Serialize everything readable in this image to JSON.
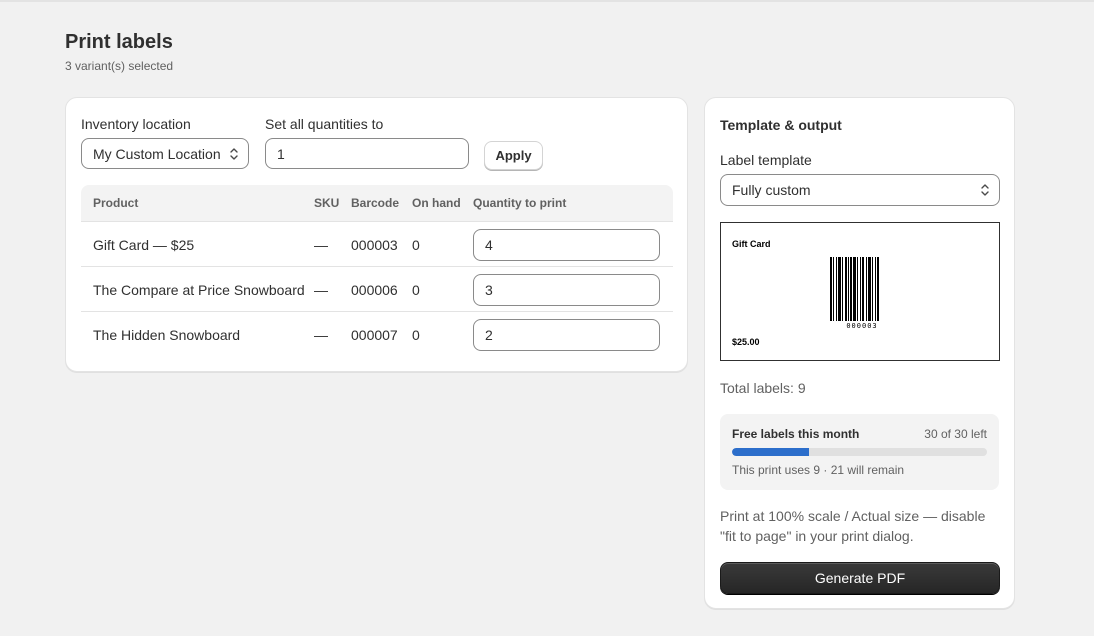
{
  "header": {
    "title": "Print labels",
    "subtitle": "3 variant(s) selected"
  },
  "controls": {
    "location_label": "Inventory location",
    "location_value": "My Custom Location",
    "set_all_label": "Set all quantities to",
    "set_all_value": "1",
    "apply_label": "Apply"
  },
  "table": {
    "headers": [
      "Product",
      "SKU",
      "Barcode",
      "On hand",
      "Quantity to print"
    ],
    "rows": [
      {
        "product": "Gift Card — $25",
        "sku": "—",
        "barcode": "000003",
        "on_hand": "0",
        "quantity": "4"
      },
      {
        "product": "The Compare at Price Snowboard",
        "sku": "—",
        "barcode": "000006",
        "on_hand": "0",
        "quantity": "3"
      },
      {
        "product": "The Hidden Snowboard",
        "sku": "—",
        "barcode": "000007",
        "on_hand": "0",
        "quantity": "2"
      }
    ]
  },
  "side": {
    "title": "Template & output",
    "template_label": "Label template",
    "template_value": "Fully custom",
    "preview": {
      "name": "Gift Card",
      "price": "$25.00",
      "barcode": "000003"
    },
    "total": "Total labels: 9",
    "quota": {
      "title": "Free labels this month",
      "left": "30 of 30 left",
      "used_fraction": 0.3,
      "note": "This print uses 9 · 21 will remain"
    },
    "hint": "Print at 100% scale / Actual size — disable \"fit to page\" in your print dialog.",
    "generate_label": "Generate PDF"
  },
  "colors": {
    "accent": "#2c6ecb",
    "primary_button": "#303030",
    "background": "#f1f1f1"
  },
  "icons": {
    "select": "chevron-up-down-icon"
  }
}
